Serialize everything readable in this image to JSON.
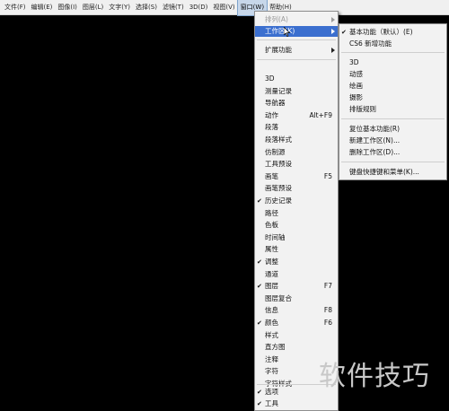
{
  "menubar": {
    "items": [
      {
        "label": "文件(F)"
      },
      {
        "label": "编辑(E)"
      },
      {
        "label": "图像(I)"
      },
      {
        "label": "图层(L)"
      },
      {
        "label": "文字(Y)"
      },
      {
        "label": "选择(S)"
      },
      {
        "label": "滤镜(T)"
      },
      {
        "label": "3D(D)"
      },
      {
        "label": "视图(V)"
      },
      {
        "label": "窗口(W)"
      },
      {
        "label": "帮助(H)"
      }
    ]
  },
  "window_menu": {
    "arrange": "排列(A)",
    "workspace": "工作区(K)",
    "extensions": "扩展功能",
    "items": [
      {
        "label": "3D",
        "shortcut": "",
        "checked": false
      },
      {
        "label": "测量记录",
        "shortcut": "",
        "checked": false
      },
      {
        "label": "导航器",
        "shortcut": "",
        "checked": false
      },
      {
        "label": "动作",
        "shortcut": "Alt+F9",
        "checked": false
      },
      {
        "label": "段落",
        "shortcut": "",
        "checked": false
      },
      {
        "label": "段落样式",
        "shortcut": "",
        "checked": false
      },
      {
        "label": "仿制源",
        "shortcut": "",
        "checked": false
      },
      {
        "label": "工具预设",
        "shortcut": "",
        "checked": false
      },
      {
        "label": "画笔",
        "shortcut": "F5",
        "checked": false
      },
      {
        "label": "画笔预设",
        "shortcut": "",
        "checked": false
      },
      {
        "label": "历史记录",
        "shortcut": "",
        "checked": true
      },
      {
        "label": "路径",
        "shortcut": "",
        "checked": false
      },
      {
        "label": "色板",
        "shortcut": "",
        "checked": false
      },
      {
        "label": "时间轴",
        "shortcut": "",
        "checked": false
      },
      {
        "label": "属性",
        "shortcut": "",
        "checked": false
      },
      {
        "label": "调整",
        "shortcut": "",
        "checked": true
      },
      {
        "label": "通道",
        "shortcut": "",
        "checked": false
      },
      {
        "label": "图层",
        "shortcut": "F7",
        "checked": true
      },
      {
        "label": "图层复合",
        "shortcut": "",
        "checked": false
      },
      {
        "label": "信息",
        "shortcut": "F8",
        "checked": false
      },
      {
        "label": "颜色",
        "shortcut": "F6",
        "checked": true
      },
      {
        "label": "样式",
        "shortcut": "",
        "checked": false
      },
      {
        "label": "直方图",
        "shortcut": "",
        "checked": false
      },
      {
        "label": "注释",
        "shortcut": "",
        "checked": false
      },
      {
        "label": "字符",
        "shortcut": "",
        "checked": false
      },
      {
        "label": "字符样式",
        "shortcut": "",
        "checked": false
      }
    ],
    "bottom_items": [
      {
        "label": "选项",
        "checked": true
      },
      {
        "label": "工具",
        "checked": true
      }
    ]
  },
  "workspace_menu": {
    "group1": [
      {
        "label": "基本功能（默认）(E)",
        "checked": true
      },
      {
        "label": "CS6 新增功能",
        "checked": false
      }
    ],
    "group2": [
      {
        "label": "3D"
      },
      {
        "label": "动感"
      },
      {
        "label": "绘画"
      },
      {
        "label": "摄影"
      },
      {
        "label": "排版规则"
      }
    ],
    "group3": [
      {
        "label": "复位基本功能(R)"
      },
      {
        "label": "新建工作区(N)..."
      },
      {
        "label": "删除工作区(D)..."
      }
    ],
    "group4": [
      {
        "label": "键盘快捷键和菜单(K)..."
      }
    ]
  },
  "watermark": "软件技巧",
  "colors": {
    "highlight": "#3b6fcf",
    "menu_bg": "#f2f2f2",
    "canvas": "#000000"
  }
}
